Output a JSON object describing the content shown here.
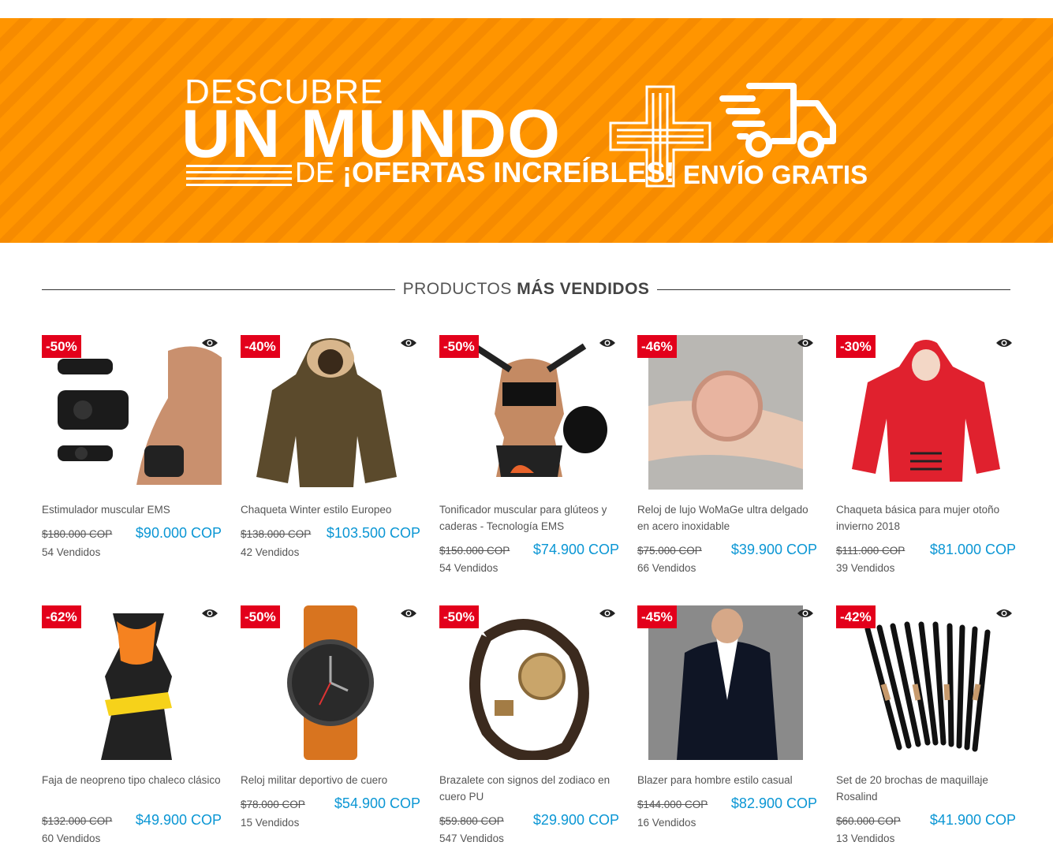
{
  "banner": {
    "line1": "DESCUBRE",
    "line2": "UN MUNDO",
    "line3_de": "DE",
    "line3_rest": "¡OFERTAS INCREÍBLES!",
    "line4": "ENVÍO GRATIS",
    "color": "#ff9500"
  },
  "section": {
    "title_light": "PRODUCTOS",
    "title_bold": "MÁS VENDIDOS"
  },
  "colors": {
    "discount_badge": "#e3001b",
    "price": "#0a96d4"
  },
  "products": [
    {
      "discount": "-50%",
      "name": "Estimulador muscular EMS",
      "old_price": "$180.000 COP",
      "price": "$90.000 COP",
      "sold": "54 Vendidos",
      "icon": "muscle-stimulator-image"
    },
    {
      "discount": "-40%",
      "name": "Chaqueta Winter estilo Europeo",
      "old_price": "$138.000 COP",
      "price": "$103.500 COP",
      "sold": "42 Vendidos",
      "icon": "parka-jacket-image"
    },
    {
      "discount": "-50%",
      "name": "Tonificador muscular para glúteos y caderas - Tecnología EMS",
      "old_price": "$150.000 COP",
      "price": "$74.900 COP",
      "sold": "54 Vendidos",
      "icon": "glute-toner-image"
    },
    {
      "discount": "-46%",
      "name": "Reloj de lujo WoMaGe ultra delgado en acero inoxidable",
      "old_price": "$75.000 COP",
      "price": "$39.900 COP",
      "sold": "66 Vendidos",
      "icon": "rose-gold-watch-image"
    },
    {
      "discount": "-30%",
      "name": "Chaqueta básica para mujer otoño invierno 2018",
      "old_price": "$111.000 COP",
      "price": "$81.000 COP",
      "sold": "39 Vendidos",
      "icon": "red-puffer-jacket-image"
    },
    {
      "discount": "-62%",
      "name": "Faja de neopreno tipo chaleco clásico",
      "old_price": "$132.000 COP",
      "price": "$49.900 COP",
      "sold": "60 Vendidos",
      "icon": "neoprene-vest-image"
    },
    {
      "discount": "-50%",
      "name": "Reloj militar deportivo de cuero",
      "old_price": "$78.000 COP",
      "price": "$54.900 COP",
      "sold": "15 Vendidos",
      "icon": "military-watch-image"
    },
    {
      "discount": "-50%",
      "name": "Brazalete con signos del zodiaco en cuero PU",
      "old_price": "$59.800 COP",
      "price": "$29.900 COP",
      "sold": "547 Vendidos",
      "icon": "zodiac-bracelet-image"
    },
    {
      "discount": "-45%",
      "name": "Blazer para hombre estilo casual",
      "old_price": "$144.000 COP",
      "price": "$82.900 COP",
      "sold": "16 Vendidos",
      "icon": "blazer-image"
    },
    {
      "discount": "-42%",
      "name": "Set de 20 brochas de maquillaje Rosalind",
      "old_price": "$60.000 COP",
      "price": "$41.900 COP",
      "sold": "13 Vendidos",
      "icon": "makeup-brushes-image"
    }
  ]
}
